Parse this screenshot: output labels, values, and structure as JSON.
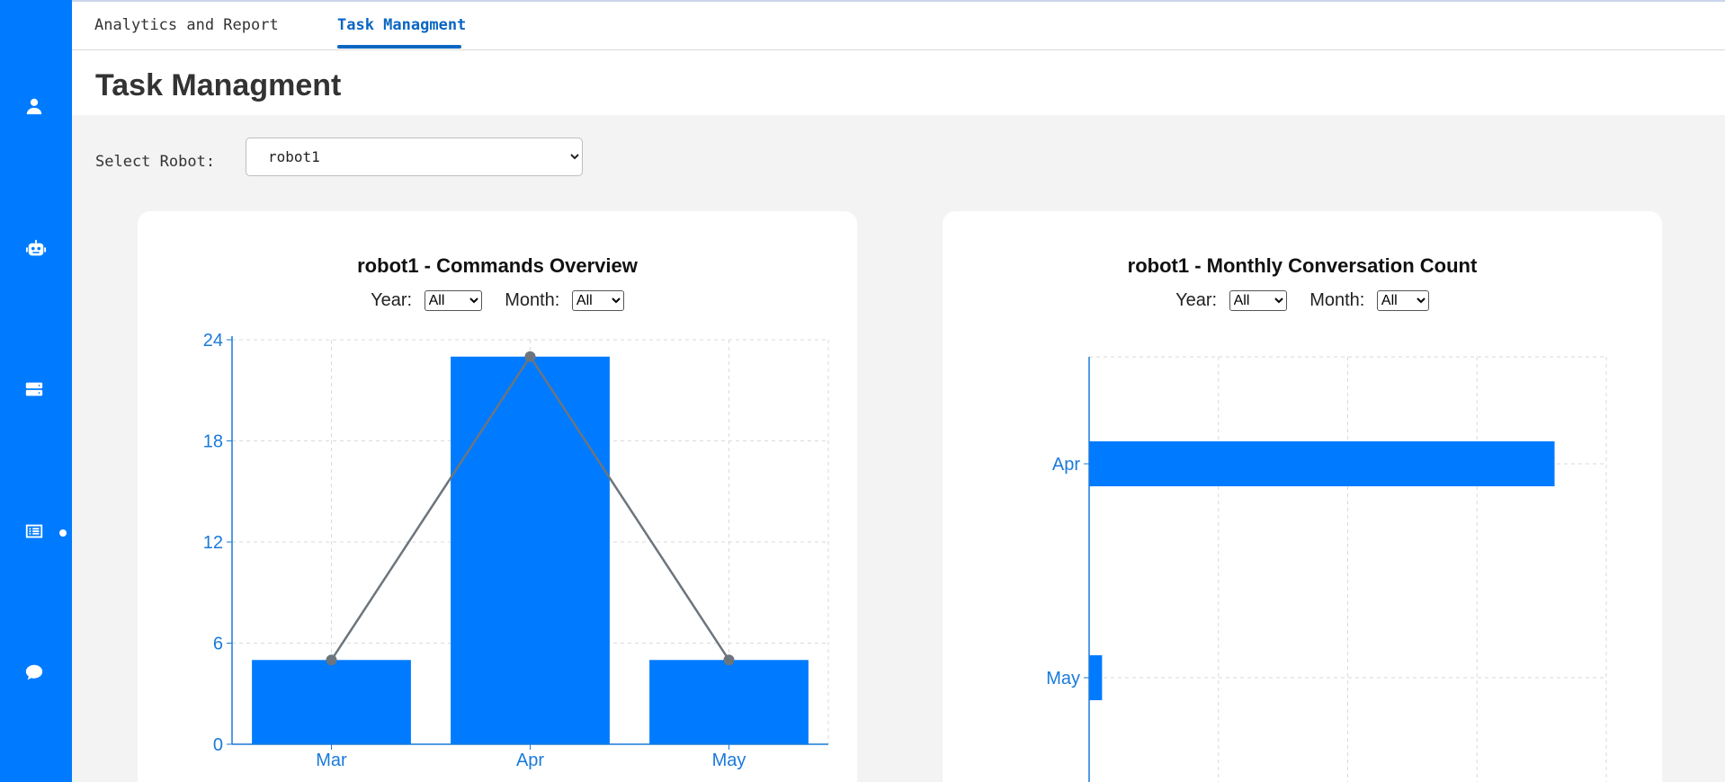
{
  "sidebar": {
    "icons": [
      "user-icon",
      "robot-icon",
      "server-icon",
      "list-icon",
      "chat-icon"
    ],
    "active_index": 3
  },
  "tabs": [
    {
      "label": "Analytics and Report",
      "active": false
    },
    {
      "label": "Task Managment",
      "active": true
    }
  ],
  "page_title": "Task Managment",
  "robot_select": {
    "label": "Select Robot:",
    "value": "robot1"
  },
  "commands_card": {
    "title": "robot1 - Commands Overview",
    "year_label": "Year:",
    "year_value": "All",
    "month_label": "Month:",
    "month_value": "All"
  },
  "conversation_card": {
    "title": "robot1 - Monthly Conversation Count",
    "year_label": "Year:",
    "year_value": "All",
    "month_label": "Month:",
    "month_value": "All"
  },
  "colors": {
    "accent": "#007bff",
    "line": "#6c757d",
    "tick": "#1a7ad9"
  },
  "chart_data": [
    {
      "type": "bar",
      "title": "robot1 - Commands Overview",
      "categories": [
        "Mar",
        "Apr",
        "May"
      ],
      "values": [
        5,
        23,
        5
      ],
      "line_overlay": [
        5,
        23,
        5
      ],
      "ylim": [
        0,
        24
      ],
      "yticks": [
        0,
        6,
        12,
        18,
        24
      ],
      "grid": true
    },
    {
      "type": "bar",
      "orientation": "horizontal",
      "title": "robot1 - Monthly Conversation Count",
      "categories": [
        "Apr",
        "May"
      ],
      "values": [
        36,
        1
      ],
      "xlim": [
        0,
        40
      ],
      "grid": true
    }
  ]
}
